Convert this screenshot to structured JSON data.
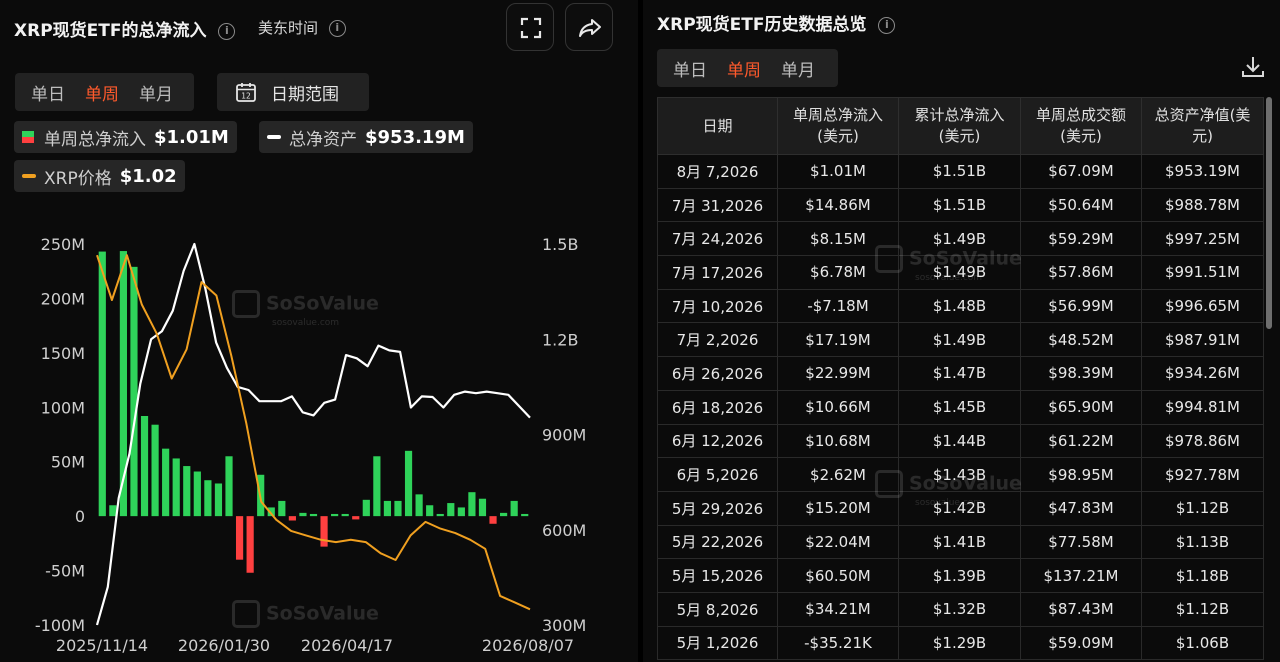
{
  "left": {
    "title": "XRP现货ETF的总净流入",
    "timezone": "美东时间",
    "period_tabs": [
      "单日",
      "单周",
      "单月"
    ],
    "active_period": "单周",
    "date_range_label": "日期范围",
    "calendar_day": "12",
    "legend": {
      "weekly_inflow_label": "单周总净流入",
      "weekly_inflow_value": "$1.01M",
      "net_assets_label": "总净资产",
      "net_assets_value": "$953.19M",
      "price_label": "XRP价格",
      "price_value": "$1.02"
    },
    "watermark": {
      "brand": "SoSoValue",
      "site": "sosovalue.com"
    }
  },
  "chart_data": {
    "type": "bar",
    "title": "",
    "x_tick_labels": [
      "2025/11/14",
      "2026/01/30",
      "2026/04/17",
      "2026/08/07"
    ],
    "y_left": {
      "ticks": [
        "250M",
        "200M",
        "150M",
        "100M",
        "50M",
        "0",
        "-50M",
        "-100M"
      ],
      "range": [
        -100,
        250
      ],
      "unit": "M"
    },
    "y_right": {
      "ticks": [
        "1.5B",
        "1.2B",
        "900M",
        "600M",
        "300M"
      ],
      "range": [
        300,
        1500
      ],
      "unit": "M"
    },
    "series": [
      {
        "name": "单周总净流入",
        "kind": "bar",
        "color_positive": "#2fd35a",
        "color_negative": "#ff4040",
        "values": [
          243.05,
          10.0,
          243.51,
          229.01,
          92.0,
          84.0,
          62.0,
          53.0,
          46.0,
          41.0,
          33.0,
          30.0,
          55.0,
          -40.0,
          -52.0,
          38.0,
          8.0,
          14.0,
          -4.0,
          3.0,
          2.0,
          -28.0,
          2.0,
          2.0,
          -3.0,
          15.0,
          55.0,
          14.0,
          14.0,
          60.0,
          20.0,
          10.0,
          2.0,
          12.0,
          8.0,
          22.0,
          16.0,
          -7.0,
          3.0,
          14.0,
          2.0
        ]
      },
      {
        "name": "总净资产",
        "kind": "line",
        "color": "#ffffff",
        "values": [
          300,
          420,
          700,
          840,
          1060,
          1200,
          1225,
          1290,
          1415,
          1500,
          1360,
          1190,
          1110,
          1050,
          1040,
          1005,
          1005,
          1005,
          1020,
          970,
          960,
          1000,
          1010,
          1150,
          1140,
          1115,
          1180,
          1165,
          1160,
          985,
          1020,
          1018,
          985,
          1025,
          1035,
          1030,
          1035,
          1030,
          1025,
          988.78,
          953.19
        ]
      },
      {
        "name": "XRP价格",
        "kind": "line",
        "color": "#f0a020",
        "values": [
          2.6,
          2.4,
          2.6,
          2.38,
          2.25,
          2.05,
          2.18,
          2.48,
          2.42,
          2.15,
          1.85,
          1.5,
          1.42,
          1.37,
          1.35,
          1.33,
          1.32,
          1.33,
          1.32,
          1.27,
          1.24,
          1.35,
          1.41,
          1.38,
          1.36,
          1.33,
          1.29,
          1.08,
          1.05,
          1.02
        ]
      }
    ],
    "legend": "top-left",
    "grid": false
  },
  "right": {
    "title": "XRP现货ETF历史数据总览",
    "period_tabs": [
      "单日",
      "单周",
      "单月"
    ],
    "active_period": "单周",
    "table": {
      "headers": [
        {
          "line1": "日期",
          "line2": ""
        },
        {
          "line1": "单周总净流入",
          "line2": "(美元)"
        },
        {
          "line1": "累计总净流入",
          "line2": "(美元)"
        },
        {
          "line1": "单周总成交额",
          "line2": "(美元)"
        },
        {
          "line1": "总资产净值(美",
          "line2": "元)"
        }
      ],
      "rows": [
        [
          "8月 7,2026",
          "$1.01M",
          "$1.51B",
          "$67.09M",
          "$953.19M"
        ],
        [
          "7月 31,2026",
          "$14.86M",
          "$1.51B",
          "$50.64M",
          "$988.78M"
        ],
        [
          "7月 24,2026",
          "$8.15M",
          "$1.49B",
          "$59.29M",
          "$997.25M"
        ],
        [
          "7月 17,2026",
          "$6.78M",
          "$1.49B",
          "$57.86M",
          "$991.51M"
        ],
        [
          "7月 10,2026",
          "-$7.18M",
          "$1.48B",
          "$56.99M",
          "$996.65M"
        ],
        [
          "7月 2,2026",
          "$17.19M",
          "$1.49B",
          "$48.52M",
          "$987.91M"
        ],
        [
          "6月 26,2026",
          "$22.99M",
          "$1.47B",
          "$98.39M",
          "$934.26M"
        ],
        [
          "6月 18,2026",
          "$10.66M",
          "$1.45B",
          "$65.90M",
          "$994.81M"
        ],
        [
          "6月 12,2026",
          "$10.68M",
          "$1.44B",
          "$61.22M",
          "$978.86M"
        ],
        [
          "6月 5,2026",
          "$2.62M",
          "$1.43B",
          "$98.95M",
          "$927.78M"
        ],
        [
          "5月 29,2026",
          "$15.20M",
          "$1.42B",
          "$47.83M",
          "$1.12B"
        ],
        [
          "5月 22,2026",
          "$22.04M",
          "$1.41B",
          "$77.58M",
          "$1.13B"
        ],
        [
          "5月 15,2026",
          "$60.50M",
          "$1.39B",
          "$137.21M",
          "$1.18B"
        ],
        [
          "5月 8,2026",
          "$34.21M",
          "$1.32B",
          "$87.43M",
          "$1.12B"
        ],
        [
          "5月 1,2026",
          "-$35.21K",
          "$1.29B",
          "$59.09M",
          "$1.06B"
        ]
      ]
    }
  },
  "colors": {
    "accent": "#ff5a2c",
    "positive": "#3ddc6a",
    "negative": "#ff4a3d",
    "background": "#0b0b0b"
  },
  "icons": [
    "info-icon",
    "fullscreen-icon",
    "share-icon",
    "calendar-icon",
    "download-icon"
  ]
}
